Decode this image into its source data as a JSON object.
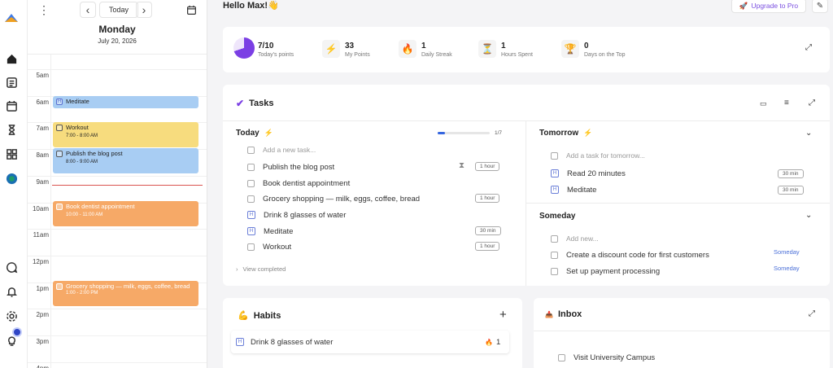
{
  "greeting": "Hello Max!👋",
  "upgrade_label": "Upgrade to Pro",
  "calendar": {
    "today_label": "Today",
    "day_name": "Monday",
    "date": "July 20, 2026",
    "hours": [
      "5am",
      "6am",
      "7am",
      "8am",
      "9am",
      "10am",
      "11am",
      "12pm",
      "1pm",
      "2pm",
      "3pm",
      "4pm"
    ],
    "events": [
      {
        "title": "Meditate",
        "time": "",
        "color": "blue",
        "habit": true
      },
      {
        "title": "Workout",
        "time": "7:00 - 8:00 AM",
        "color": "yellow",
        "habit": false
      },
      {
        "title": "Publish the blog post",
        "time": "8:00 - 9:00 AM",
        "color": "blue",
        "habit": false
      },
      {
        "title": "Book dentist appointment",
        "time": "10:00 - 11:00 AM",
        "color": "orange",
        "habit": false
      },
      {
        "title": "Grocery shopping — milk, eggs, coffee, bread",
        "time": "1:00 - 2:00 PM",
        "color": "orange",
        "habit": false
      }
    ]
  },
  "stats": [
    {
      "value": "7/10",
      "label": "Today's points",
      "icon": "pie-chart"
    },
    {
      "value": "33",
      "label": "My Points",
      "icon": "lightning-icon"
    },
    {
      "value": "1",
      "label": "Daily Streak",
      "icon": "fire-icon"
    },
    {
      "value": "1",
      "label": "Hours Spent",
      "icon": "hourglass-icon"
    },
    {
      "value": "0",
      "label": "Days on the Top",
      "icon": "trophy-icon"
    }
  ],
  "today_points_fraction": 0.7,
  "tasks": {
    "title": "Tasks",
    "today": {
      "title": "Today",
      "progress_text": "1/7",
      "progress_fraction": 0.143,
      "add_placeholder": "Add a new task...",
      "items": [
        {
          "label": "Publish the blog post",
          "habit": false,
          "duration": "1 hour",
          "timer": true
        },
        {
          "label": "Book dentist appointment",
          "habit": false,
          "duration": ""
        },
        {
          "label": "Grocery shopping — milk, eggs, coffee, bread",
          "habit": false,
          "duration": "1 hour"
        },
        {
          "label": "Drink 8 glasses of water",
          "habit": true,
          "duration": ""
        },
        {
          "label": "Meditate",
          "habit": true,
          "duration": "30 min"
        },
        {
          "label": "Workout",
          "habit": false,
          "duration": "1 hour"
        }
      ],
      "view_completed": "View completed"
    },
    "tomorrow": {
      "title": "Tomorrow",
      "add_placeholder": "Add a task for tomorrow...",
      "items": [
        {
          "label": "Read 20 minutes",
          "duration": "30 min"
        },
        {
          "label": "Meditate",
          "duration": "30 min"
        }
      ]
    },
    "someday": {
      "title": "Someday",
      "add_placeholder": "Add new...",
      "items": [
        {
          "label": "Create a discount code for first customers",
          "tag": "Someday"
        },
        {
          "label": "Set up payment processing",
          "tag": "Someday"
        }
      ]
    }
  },
  "habits": {
    "title": "Habits",
    "items": [
      {
        "label": "Drink 8 glasses of water",
        "streak": "1"
      }
    ]
  },
  "inbox": {
    "title": "Inbox",
    "items": [
      {
        "label": "Visit University Campus"
      }
    ]
  },
  "colors": {
    "accent": "#7b3fe4",
    "link": "#4a6fd8",
    "event_blue": "#a8cdf3",
    "event_yellow": "#f7dc7e",
    "event_orange": "#f6a967"
  }
}
